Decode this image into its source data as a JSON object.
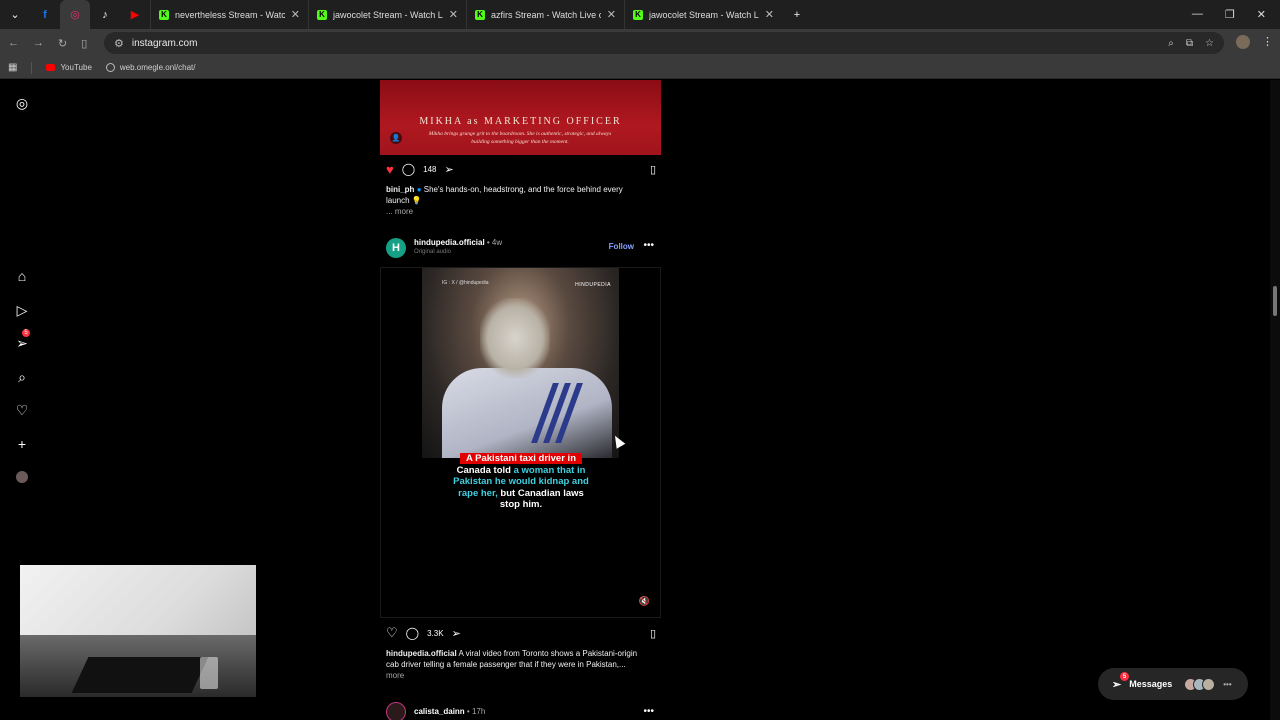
{
  "browser": {
    "tabs": [
      {
        "label": "nevertheless Stream - Watch Live on Kick",
        "icon": "kick-icon"
      },
      {
        "label": "jawocolet Stream - Watch Live on Kick",
        "icon": "kick-icon"
      },
      {
        "label": "azfirs Stream - Watch Live on Kick",
        "icon": "kick-icon"
      },
      {
        "label": "jawocolet Stream - Watch Live on Kick",
        "icon": "kick-icon"
      }
    ],
    "new_tab_label": "+",
    "address": "instagram.com",
    "bookmarks": [
      {
        "label": "YouTube",
        "icon": "youtube-icon"
      },
      {
        "label": "web.omegle.onl/chat/",
        "icon": "globe-icon"
      }
    ]
  },
  "sidebar": {
    "items": [
      {
        "name": "instagram-logo-icon",
        "glyph": "◎"
      },
      {
        "name": "home-icon",
        "glyph": "⌂"
      },
      {
        "name": "reels-icon",
        "glyph": "▷"
      },
      {
        "name": "direct-icon",
        "glyph": "➢"
      },
      {
        "name": "search-icon",
        "glyph": "⌕"
      },
      {
        "name": "notifications-icon",
        "glyph": "♡"
      },
      {
        "name": "create-icon",
        "glyph": "+"
      },
      {
        "name": "profile-icon",
        "glyph": "●"
      }
    ],
    "direct_badge": "5"
  },
  "post1": {
    "poster_title": "MIKHA as MARKETING OFFICER",
    "poster_sub": "Mikha brings grunge grit to the boardroom. She is authentic, strategic, and always building something bigger than the moment.",
    "liked": true,
    "comment_count": "148",
    "caption_user": "bini_ph",
    "caption_text": "She's hands-on, headstrong, and the force behind every launch 💡",
    "more": "... more"
  },
  "post2": {
    "username": "hindupedia.official",
    "time": "• 4w",
    "audio": "Original audio",
    "follow": "Follow",
    "avatar_letter": "H",
    "video_watermark_left": "IG : X / @hindupedia",
    "video_watermark_right": "HINDUPEDIA",
    "subtitle_red": "A Pakistani taxi driver in",
    "subtitle_w1": "Canada told",
    "subtitle_c1": "a woman that in",
    "subtitle_c2": "Pakistan he would kidnap and",
    "subtitle_c3": "rape her,",
    "subtitle_w2": "but Canadian laws",
    "subtitle_w3": "stop him.",
    "comment_count": "3.3K",
    "caption_user": "hindupedia.official",
    "caption_text": "A viral video from Toronto shows a Pakistani-origin cab driver telling a female passenger that if they were in Pakistan,...",
    "more": "more"
  },
  "post3": {
    "username": "calista_dainn",
    "time": "• 17h"
  },
  "messages": {
    "label": "Messages",
    "badge": "5"
  },
  "colors": {
    "background": "#000000",
    "like_red": "#ff3040",
    "follow_blue": "#85a1ff",
    "kick_green": "#53fc18"
  }
}
